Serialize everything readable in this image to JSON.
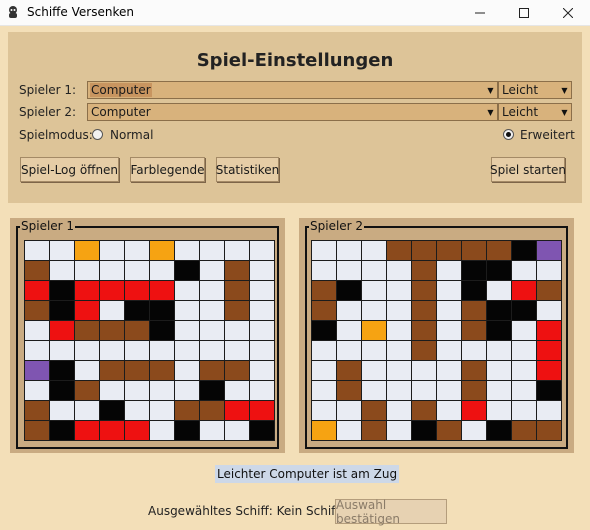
{
  "window": {
    "title": "Schiffe Versenken",
    "icon": "ship-app-icon",
    "controls": [
      "minimize-icon",
      "maximize-icon",
      "close-icon"
    ]
  },
  "settings": {
    "heading": "Spiel-Einstellungen",
    "player1": {
      "label": "Spieler 1:",
      "type": "Computer",
      "difficulty": "Leicht"
    },
    "player2": {
      "label": "Spieler 2:",
      "type": "Computer",
      "difficulty": "Leicht"
    },
    "mode": {
      "label": "Spielmodus:",
      "options": [
        "Normal",
        "Erweitert"
      ],
      "selected": "Erweitert"
    },
    "buttons": {
      "log": "Spiel-Log öffnen",
      "legend": "Farblegende",
      "stats": "Statistiken",
      "start": "Spiel starten"
    }
  },
  "boards": [
    {
      "title": "Spieler 1",
      "rows": [
        "0010010000",
        "2000004020",
        "3433330020",
        "2430440020",
        "0322240000",
        "0000000000",
        "5402220220",
        "0420000400",
        "2004002233",
        "2433304004"
      ]
    },
    {
      "title": "Spieler 2",
      "rows": [
        "0002222245",
        "0000204400",
        "2400204032",
        "2000202440",
        "4010202403",
        "0000200003",
        "0200002003",
        "0200002004",
        "0020203000",
        "1020420422"
      ]
    }
  ],
  "legend_colors": {
    "water": "#e9ecf3",
    "orange": "#f6a312",
    "ship": "#8b4a1c",
    "hit": "#ee1111",
    "miss": "#050505",
    "purple": "#7f55b1"
  },
  "status": "Leichter Computer ist am Zug",
  "selection": {
    "label": "Ausgewähltes Schiff: Kein Schiff",
    "confirm": "Auswahl bestätigen"
  }
}
